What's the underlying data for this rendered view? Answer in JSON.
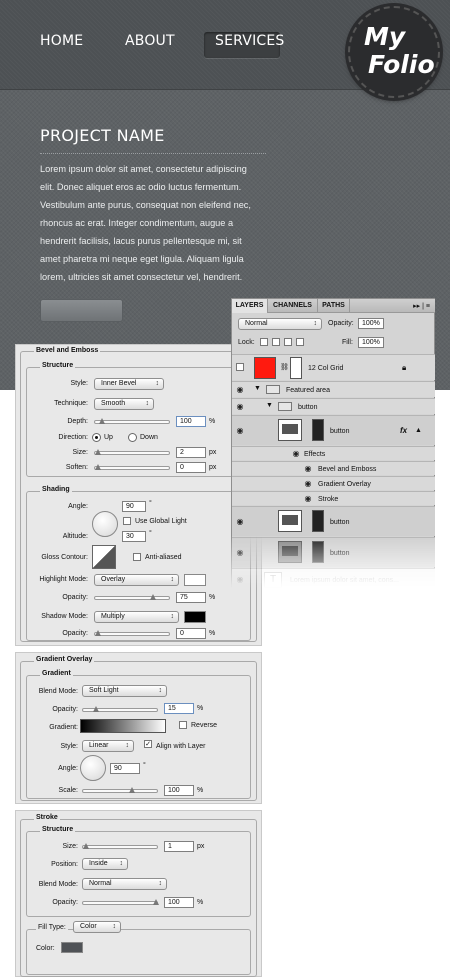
{
  "nav": {
    "home": "HOME",
    "about": "ABOUT",
    "services": "SERVICES"
  },
  "logo": {
    "line1": "My",
    "line2": "Folio"
  },
  "project": {
    "title": "PROJECT NAME",
    "lorem": [
      "Lorem ipsum dolor sit amet, consectetur adipiscing",
      "elit. Donec aliquet eros ac odio luctus fermentum.",
      "Vestibulum ante purus, consequat non eleifend nec,",
      "rhoncus ac erat. Integer condimentum, augue a",
      "hendrerit facilisis, lacus purus pellentesque mi, sit",
      "amet pharetra mi neque eget ligula. Aliquam ligula",
      "lorem, ultricies sit amet consectetur vel, hendrerit."
    ]
  },
  "colors": {
    "hero_bg": "#5e6265",
    "nav_bg": "#4d5154",
    "layer_red": "#ff1a0f",
    "stroke_color": "#4f5256"
  },
  "bevel": {
    "title": "Bevel and Emboss",
    "structure": "Structure",
    "style_label": "Style:",
    "style": "Inner Bevel",
    "technique_label": "Technique:",
    "technique": "Smooth",
    "depth_label": "Depth:",
    "depth": "100",
    "pct": "%",
    "direction_label": "Direction:",
    "up": "Up",
    "down": "Down",
    "size_label": "Size:",
    "size": "2",
    "px": "px",
    "soften_label": "Soften:",
    "soften": "0",
    "shading": "Shading",
    "angle_label": "Angle:",
    "angle": "90",
    "deg": "°",
    "global_light": "Use Global Light",
    "altitude_label": "Altitude:",
    "altitude": "30",
    "gloss_label": "Gloss Contour:",
    "anti": "Anti-aliased",
    "hl_mode_label": "Highlight Mode:",
    "hl_mode": "Overlay",
    "opacity_label": "Opacity:",
    "hl_opacity": "75",
    "shadow_label": "Shadow Mode:",
    "shadow_mode": "Multiply",
    "shadow_opacity": "0"
  },
  "gradient": {
    "title": "Gradient Overlay",
    "sub": "Gradient",
    "blend_label": "Blend Mode:",
    "blend": "Soft Light",
    "opacity_label": "Opacity:",
    "opacity": "15",
    "pct": "%",
    "gradient_label": "Gradient:",
    "reverse": "Reverse",
    "style_label": "Style:",
    "style": "Linear",
    "align": "Align with Layer",
    "angle_label": "Angle:",
    "angle": "90",
    "deg": "°",
    "scale_label": "Scale:",
    "scale": "100"
  },
  "stroke": {
    "title": "Stroke",
    "structure": "Structure",
    "size_label": "Size:",
    "size": "1",
    "px": "px",
    "position_label": "Position:",
    "position": "Inside",
    "blend_label": "Blend Mode:",
    "blend": "Normal",
    "opacity_label": "Opacity:",
    "opacity": "100",
    "pct": "%",
    "filltype_label": "Fill Type:",
    "filltype": "Color",
    "color_label": "Color:"
  },
  "layers": {
    "tabs": [
      "LAYERS",
      "CHANNELS",
      "PATHS"
    ],
    "menu": "▸▸ | ≡",
    "blend": "Normal",
    "opacity_label": "Opacity:",
    "opacity": "100%",
    "lock_label": "Lock:",
    "fill_label": "Fill:",
    "fill": "100%",
    "rows": {
      "grid": "12 Col Grid",
      "featured": "Featured area",
      "button_group": "button",
      "button1": "button",
      "effects": "Effects",
      "bevel": "Bevel and Emboss",
      "gradient": "Gradient Overlay",
      "stroke": "Stroke",
      "button2": "button",
      "button3": "button",
      "text": "Lorem ipsum dolor sit amet, cons..."
    },
    "fx": "fx"
  }
}
